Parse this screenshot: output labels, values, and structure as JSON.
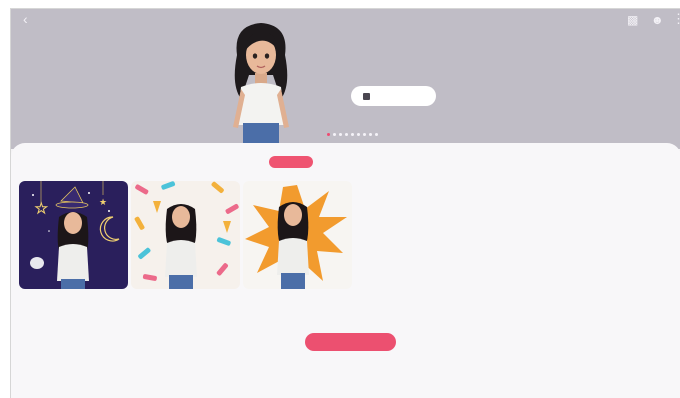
{
  "header": {
    "back_icon": "back-arrow-icon",
    "actions": [
      "gift-icon",
      "person-add-icon",
      "more-options-icon"
    ],
    "headline": "",
    "button_label": "",
    "button_icon": "camera-icon",
    "page_indicator": {
      "count": 9,
      "active_index": 0
    }
  },
  "tabs": {
    "items": [
      "",
      "",
      "",
      "",
      "",
      ""
    ],
    "active_index": 1
  },
  "stickers": [
    {
      "theme": "night-sky-witch",
      "background": "#2a1f5c"
    },
    {
      "theme": "ice-cream-pattern",
      "background": "#f6f1ec"
    },
    {
      "theme": "comic-burst",
      "background": "#f7f5f2"
    }
  ],
  "cta": {
    "label": ""
  },
  "colors": {
    "banner": "#c0bdc6",
    "accent": "#ee4b71",
    "panel": "#f8f7f9"
  }
}
